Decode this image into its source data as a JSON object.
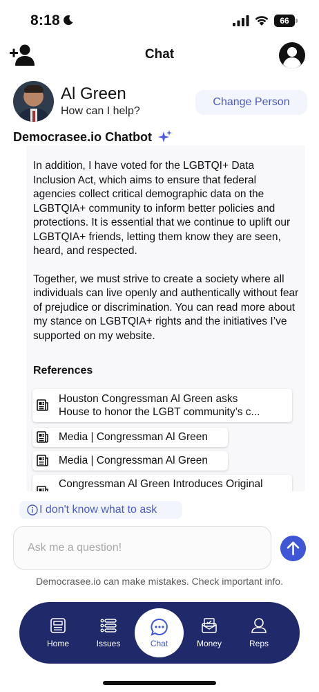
{
  "status_bar": {
    "time": "8:18",
    "battery": "66"
  },
  "header": {
    "title": "Chat"
  },
  "person": {
    "name": "Al Green",
    "subtitle": "How can I help?",
    "change_label": "Change Person"
  },
  "bot": {
    "label": "Democrasee.io Chatbot"
  },
  "message": {
    "paragraphs": [
      "In addition, I have voted for the LGBTQI+ Data Inclusion Act, which aims to ensure that federal agencies collect critical demographic data on the LGBTQIA+ community to inform better policies and protections. It is essential that we continue to uplift our LGBTQIA+ friends, letting them know they are seen, heard, and respected.",
      "Together, we must strive to create a society where all individuals can live openly and authentically without fear of prejudice or discrimination. You can read more about my stance on LGBTQIA+ rights and the initiatives I’ve supported on my website."
    ],
    "references_heading": "References",
    "references": [
      {
        "line1": "Houston Congressman Al Green asks",
        "line2": "House to honor the LGBT community’s c..."
      },
      {
        "line1": "Media | Congressman Al Green"
      },
      {
        "line1": "Media | Congressman Al Green"
      },
      {
        "line1": "Congressman Al Green Introduces Original"
      }
    ]
  },
  "suggestion": {
    "label": "I don't know what to ask"
  },
  "input": {
    "placeholder": "Ask me a question!",
    "value": ""
  },
  "disclaimer": "Democrasee.io can make mistakes. Check important info.",
  "nav": {
    "home": "Home",
    "issues": "Issues",
    "chat": "Chat",
    "money": "Money",
    "reps": "Reps"
  },
  "colors": {
    "accent": "#3f56d6",
    "nav_bg": "#202a6a",
    "link": "#4a5bc4"
  }
}
